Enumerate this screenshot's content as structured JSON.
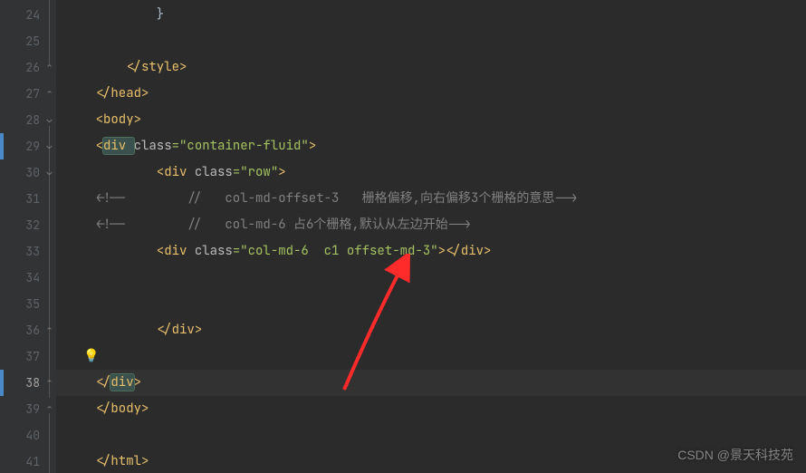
{
  "gutter": {
    "lines": [
      24,
      25,
      26,
      27,
      28,
      29,
      30,
      31,
      32,
      33,
      34,
      35,
      36,
      37,
      38,
      39,
      40,
      41
    ],
    "current": 38
  },
  "code": {
    "l24": "            }",
    "l26_open": "        </",
    "l26_tag": "style",
    "l26_close": ">",
    "l27_open": "    </",
    "l27_tag": "head",
    "l27_close": ">",
    "l28_open": "    <",
    "l28_tag": "body",
    "l28_close": ">",
    "l29_open": "    <",
    "l29_tag": "div ",
    "l29_attr": "class",
    "l29_eq": "=",
    "l29_val": "\"container-fluid\"",
    "l29_close": ">",
    "l30_indent": "            <",
    "l30_tag": "div ",
    "l30_attr": "class",
    "l30_eq": "=",
    "l30_val": "\"row\"",
    "l30_close": ">",
    "l31": "    <!--        //   col-md-offset-3   栅格偏移,向右偏移3个栅格的意思-->",
    "l32": "    <!--        //   col-md-6 占6个栅格,默认从左边开始-->",
    "l33_indent": "            <",
    "l33_tag": "div ",
    "l33_attr": "class",
    "l33_eq": "=",
    "l33_val": "\"col-md-6  c1 offset-md-3\"",
    "l33_close": "></",
    "l33_tag2": "div",
    "l33_close2": ">",
    "l36_indent": "            </",
    "l36_tag": "div",
    "l36_close": ">",
    "l38_indent": "    </",
    "l38_tag": "div",
    "l38_close": ">",
    "l39_indent": "    </",
    "l39_tag": "body",
    "l39_close": ">",
    "l41_indent": "    </",
    "l41_tag": "html",
    "l41_close": ">"
  },
  "watermark": "CSDN @景天科技苑",
  "icons": {
    "bulb": "💡"
  }
}
